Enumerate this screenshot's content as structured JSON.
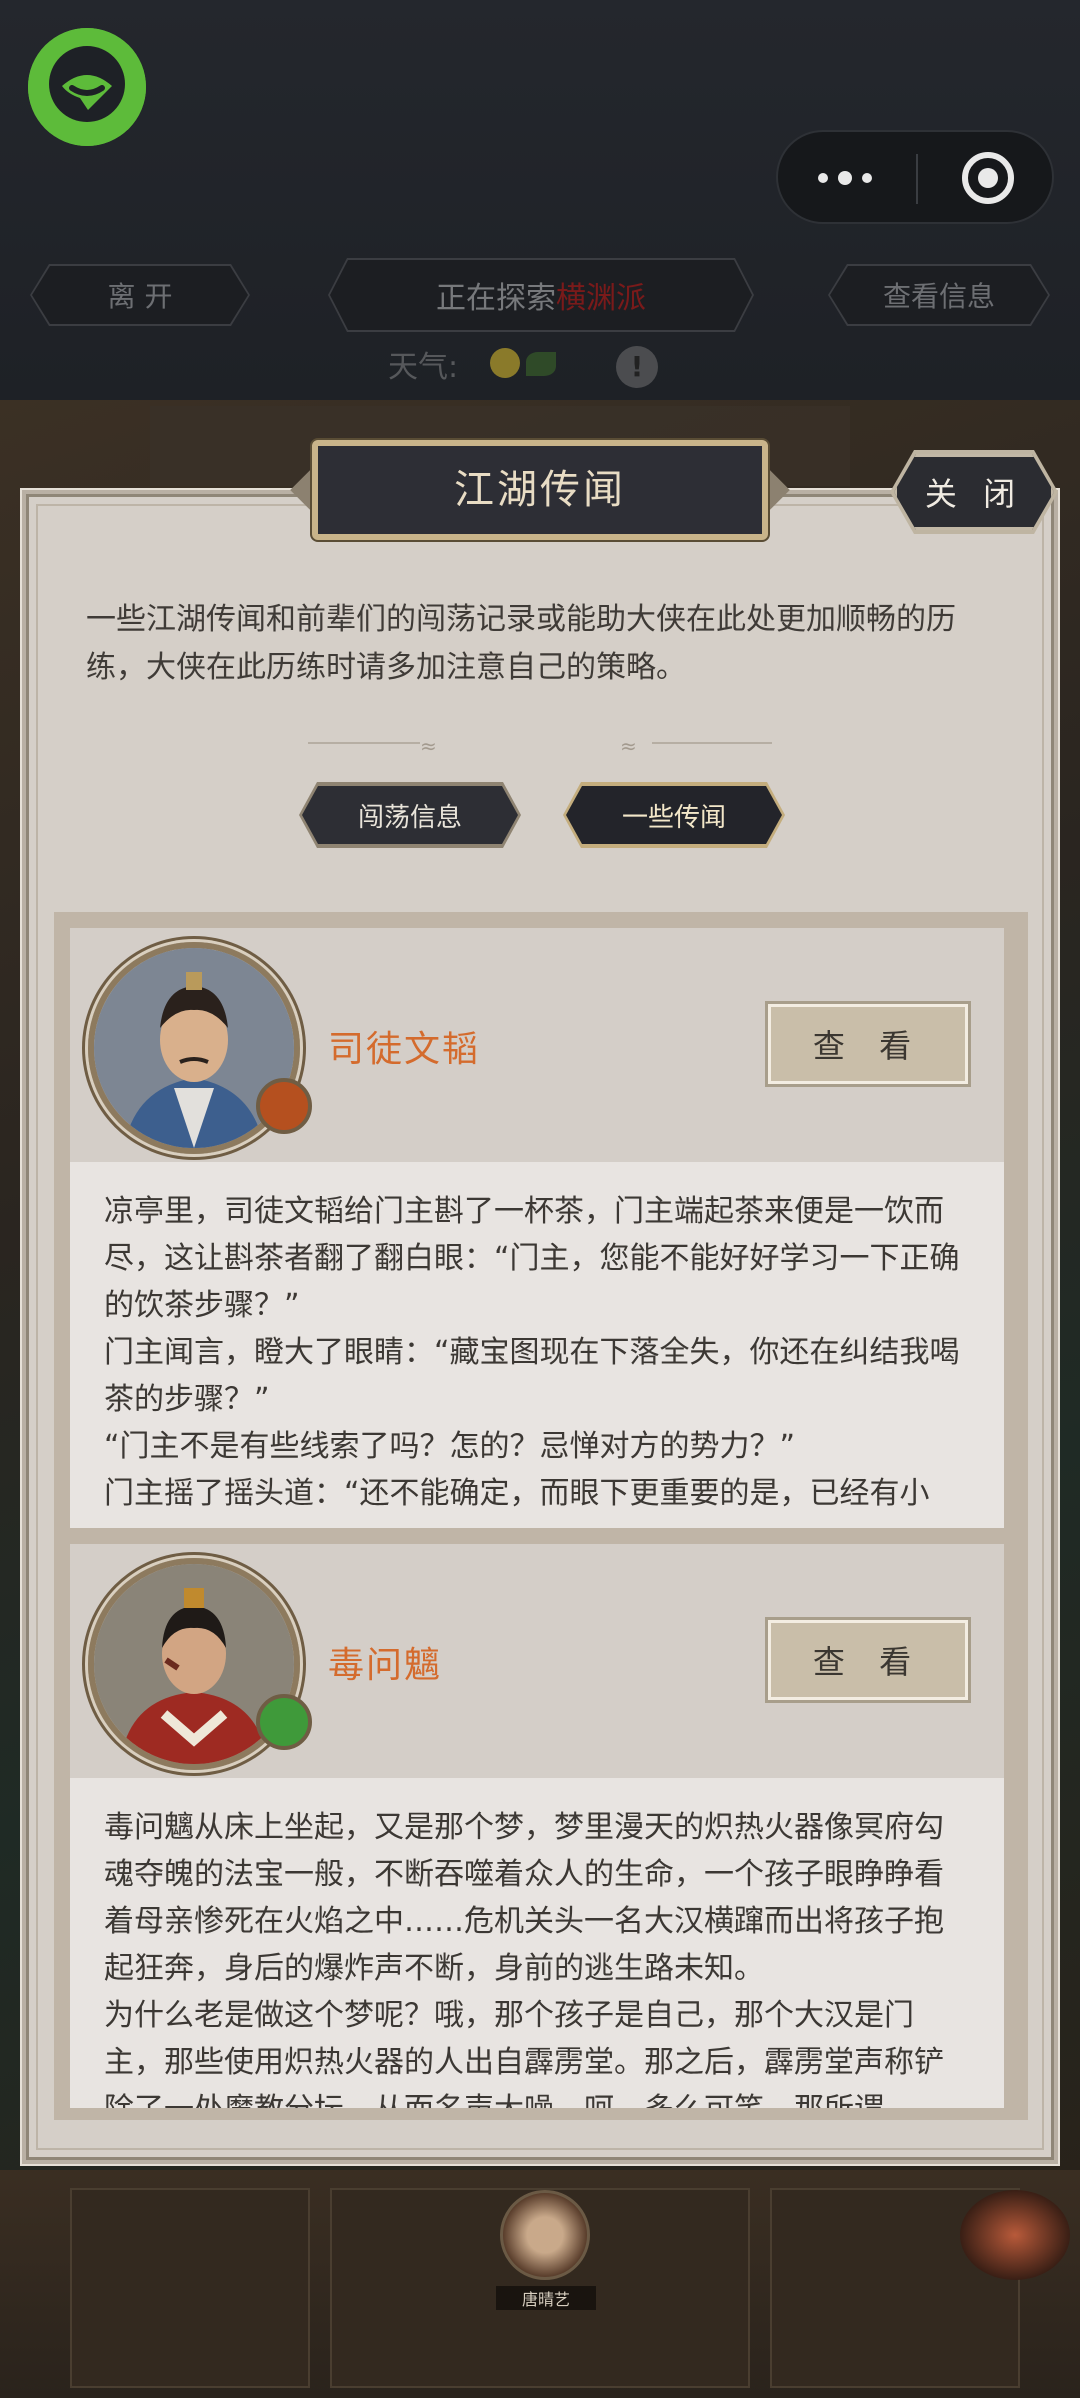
{
  "header": {
    "leave_label": "离 开",
    "exploring_prefix": "正在探索",
    "exploring_place": "横渊派",
    "view_info_label": "查看信息",
    "weather_label": "天气:",
    "warning_glyph": "!"
  },
  "panel": {
    "title": "江湖传闻",
    "close_label": "关 闭",
    "intro": "一些江湖传闻和前辈们的闯荡记录或能助大侠在此处更加顺畅的历练，大侠在此历练时请多加注意自己的策略。",
    "tabs": [
      {
        "label": "闯荡信息",
        "active": false
      },
      {
        "label": "一些传闻",
        "active": true
      }
    ]
  },
  "rumors": [
    {
      "name": "司徒文韬",
      "view_label": "查 看",
      "text": "凉亭里，司徒文韬给门主斟了一杯茶，门主端起茶来便是一饮而尽，这让斟茶者翻了翻白眼：“门主，您能不能好好学习一下正确的饮茶步骤？”\n门主闻言，瞪大了眼睛：“藏宝图现在下落全失，你还在纠结我喝茶的步骤？”\n“门主不是有些线索了吗？怎的？忌惮对方的势力？”\n门主摇了摇头道：“还不能确定，而眼下更重要的是，已经有小",
      "badge_color": "#b5501f",
      "robe_color": "#3d5f8e"
    },
    {
      "name": "毒问魑",
      "view_label": "查 看",
      "text": "毒问魑从床上坐起，又是那个梦，梦里漫天的炽热火器像冥府勾魂夺魄的法宝一般，不断吞噬着众人的生命，一个孩子眼睁睁看着母亲惨死在火焰之中……危机关头一名大汉横蹿而出将孩子抱起狂奔，身后的爆炸声不断，身前的逃生路未知。\n为什么老是做这个梦呢？哦，那个孩子是自己，那个大汉是门主，那些使用炽热火器的人出自霹雳堂。那之后，霹雳堂声称铲除了一处魔教分坛，从而名声大噪。呵，多么可笑，那所谓",
      "badge_color": "#3f9a3a",
      "robe_color": "#9e2a22"
    }
  ],
  "background": {
    "mini_name": "唐晴艺"
  }
}
